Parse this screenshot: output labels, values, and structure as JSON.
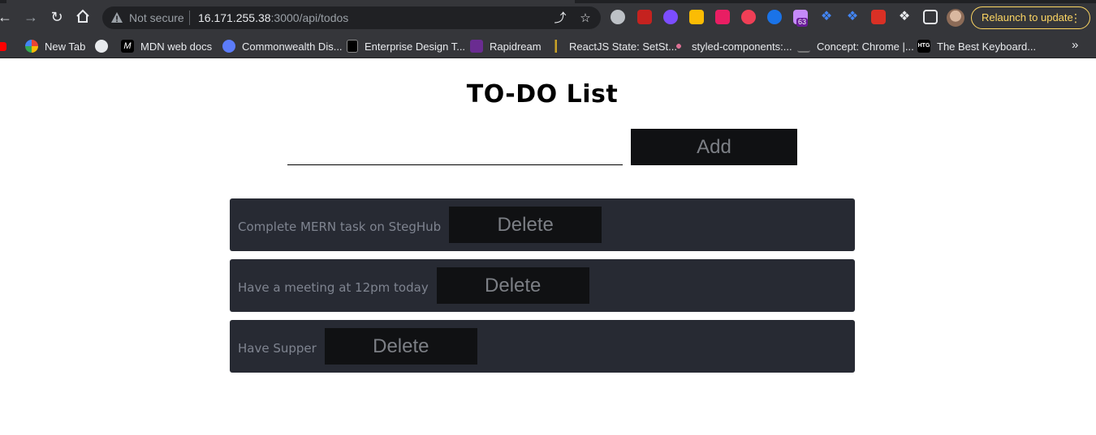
{
  "browser": {
    "not_secure_label": "Not secure",
    "url_host": "16.171.255.38",
    "url_path": ":3000/api/todos",
    "relaunch_label": "Relaunch to update",
    "extension_badge": "63",
    "bookmarks": [
      {
        "label": "New Tab",
        "icon": "google-icon"
      },
      {
        "label": "",
        "icon": "github-icon"
      },
      {
        "label": "MDN web docs",
        "icon": "mdn-icon"
      },
      {
        "label": "Commonwealth Dis...",
        "icon": "globe-icon"
      },
      {
        "label": "Enterprise Design T...",
        "icon": "enterprise-icon"
      },
      {
        "label": "Rapidream",
        "icon": "rapidream-icon"
      },
      {
        "label": "ReactJS State: SetSt...",
        "icon": "react-icon"
      },
      {
        "label": "styled-components:...",
        "icon": "styled-components-icon"
      },
      {
        "label": "Concept: Chrome |...",
        "icon": "concept-icon"
      },
      {
        "label": "The Best Keyboard...",
        "icon": "htg-icon"
      }
    ]
  },
  "app": {
    "title": "TO-DO List",
    "input_value": "",
    "add_label": "Add",
    "delete_label": "Delete",
    "todos": [
      {
        "text": "Complete MERN task on StegHub"
      },
      {
        "text": "Have a meeting at 12pm today"
      },
      {
        "text": "Have Supper"
      }
    ]
  },
  "colors": {
    "item_bg": "#272a33",
    "button_bg": "#101113",
    "button_text": "#7c7f85",
    "item_text": "#7f8490"
  }
}
